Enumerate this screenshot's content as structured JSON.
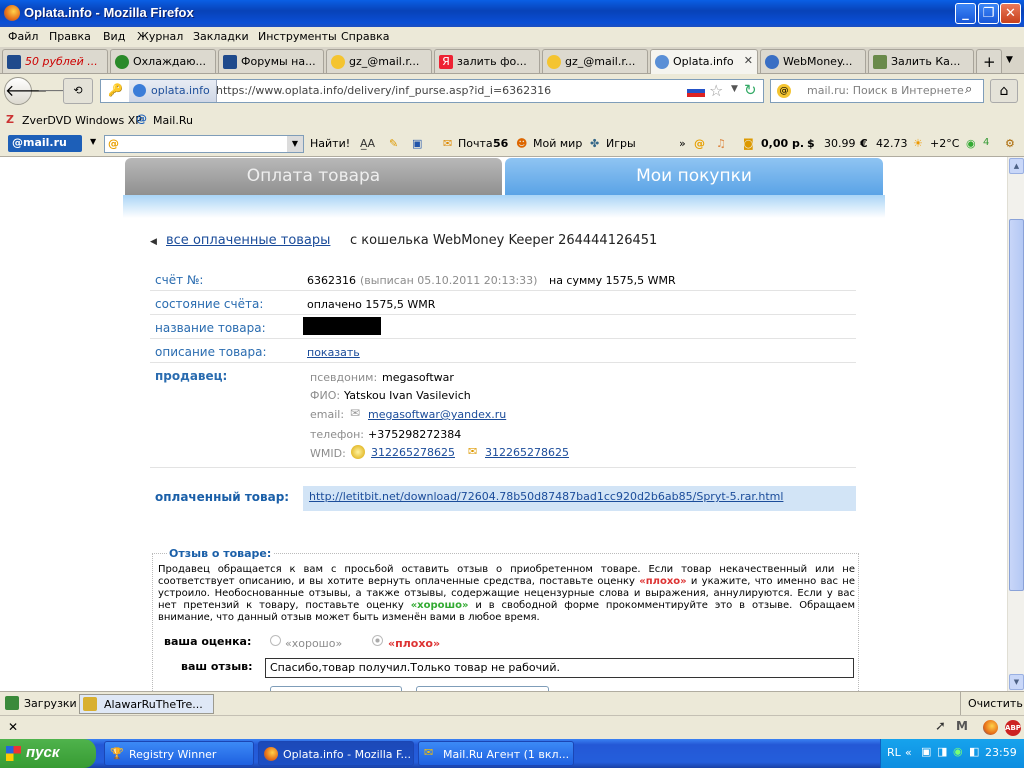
{
  "window": {
    "title": "Oplata.info - Mozilla Firefox"
  },
  "menu": [
    "Файл",
    "Правка",
    "Вид",
    "Журнал",
    "Закладки",
    "Инструменты",
    "Справка"
  ],
  "tabs": [
    {
      "label": "50 рублей ...",
      "active": false
    },
    {
      "label": "Охлаждаю...",
      "active": false
    },
    {
      "label": "Форумы на...",
      "active": false
    },
    {
      "label": "gz_@mail.r...",
      "active": false
    },
    {
      "label": "залить фо...",
      "active": false
    },
    {
      "label": "gz_@mail.r...",
      "active": false
    },
    {
      "label": "Oplata.info",
      "active": true
    },
    {
      "label": "WebMoney...",
      "active": false
    },
    {
      "label": "Залить Ка...",
      "active": false
    }
  ],
  "nav": {
    "site": "oplata.info",
    "url": "https://www.oplata.info/delivery/inf_purse.asp?id_i=6362316",
    "search_placeholder": "mail.ru: Поиск в Интернете"
  },
  "bookmarks": [
    "ZverDVD Windows XP",
    "Mail.Ru"
  ],
  "mailru_bar": {
    "logo": "@mail.ru",
    "find": "Найти!",
    "mail": "Почта",
    "mail_count": "56",
    "myworld": "Мой мир",
    "games": "Игры",
    "balance": "0,00 р.",
    "usd": "30.99",
    "eur": "42.73",
    "weather": "+2°C",
    "traffic": "4"
  },
  "page": {
    "tab_pay": "Оплата товара",
    "tab_purchases": "Мои покупки",
    "back_link": "все оплаченные товары",
    "wallet_text": "с кошелька WebMoney Keeper 264444126451",
    "invoice_label": "счёт №:",
    "invoice_number": "6362316",
    "invoice_issued": "(выписан 05.10.2011 20:13:33)",
    "invoice_sum": "на сумму 1575,5 WMR",
    "state_label": "состояние счёта:",
    "state_value": "оплачено 1575,5 WMR",
    "name_label": "название товара:",
    "desc_label": "описание товара:",
    "desc_link": "показать",
    "seller_label": "продавец:",
    "nick_label": "псевдоним:",
    "nick_value": "megasoftwar",
    "fio_label": "ФИО:",
    "fio_value": "Yatskou Ivan Vasilevich",
    "email_label": "email:",
    "email_value": "megasoftwar@yandex.ru",
    "phone_label": "телефон:",
    "phone_value": "+375298272384",
    "wmid_label": "WMID:",
    "wmid1": "312265278625",
    "wmid2": "312265278625",
    "paid_label": "оплаченный товар:",
    "paid_link": "http://letitbit.net/download/72604.78b50d87487bad1cc920d2b6ab85/Spryt-5.rar.html",
    "review_legend": "Отзыв о товаре:",
    "review_text_1": "Продавец обращается к вам с просьбой оставить отзыв о приобретенном товаре. Если товар некачественный или не соответствует описанию, и вы хотите вернуть оплаченные средства, поставьте оценку ",
    "bad_word": "«плохо»",
    "review_text_2": " и укажите, что именно вас не устроило. Необоснованные отзывы, а также отзывы, содержащие нецензурные слова и выражения, аннулируются. Если у вас нет претензий к товару, поставьте оценку ",
    "good_word": "«хорошо»",
    "review_text_3": " и в свободной форме прокомментируйте это в отзыве. Обращаем внимание, что данный отзыв может быть изменён вами в любое время.",
    "rating_label": "ваша оценка:",
    "rating_good": "«хорошо»",
    "rating_bad": "«плохо»",
    "feedback_label": "ваш отзыв:",
    "feedback_value": "Спасибо,товар получил.Только товар не рабочий."
  },
  "statusbar": {
    "downloads": "Загрузки",
    "item": "AlawarRuTheTre...",
    "clear": "Очистить"
  },
  "taskbar": {
    "start": "пуск",
    "tasks": [
      "Registry Winner",
      "Oplata.info - Mozilla F...",
      "Mail.Ru Агент (1 вкл..."
    ],
    "lang": "RL",
    "time": "23:59"
  }
}
